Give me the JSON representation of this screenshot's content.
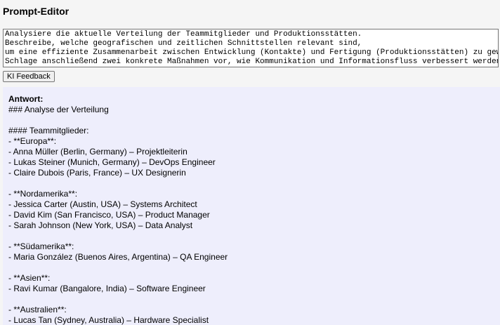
{
  "header": {
    "title": "Prompt-Editor"
  },
  "prompt": {
    "text": "Analysiere die aktuelle Verteilung der Teammitglieder und Produktionsstätten.\nBeschreibe, welche geografischen und zeitlichen Schnittstellen relevant sind,\num eine effiziente Zusammenarbeit zwischen Entwicklung (Kontakte) und Fertigung (Produktionsstätten) zu gewährleisten.\nSchlage anschließend zwei konkrete Maßnahmen vor, wie Kommunikation und Informationsfluss verbessert werden könnten."
  },
  "toolbar": {
    "feedback_label": "KI Feedback"
  },
  "answer": {
    "heading": "Antwort:",
    "lines": [
      "### Analyse der Verteilung",
      "",
      "#### Teammitglieder:",
      "- **Europa**:",
      "- Anna Müller (Berlin, Germany) – Projektleiterin",
      "- Lukas Steiner (Munich, Germany) – DevOps Engineer",
      "- Claire Dubois (Paris, France) – UX Designerin",
      "",
      "- **Nordamerika**:",
      "- Jessica Carter (Austin, USA) – Systems Architect",
      "- David Kim (San Francisco, USA) – Product Manager",
      "- Sarah Johnson (New York, USA) – Data Analyst",
      "",
      "- **Südamerika**:",
      "- Maria González (Buenos Aires, Argentina) – QA Engineer",
      "",
      "- **Asien**:",
      "- Ravi Kumar (Bangalore, India) – Software Engineer",
      "",
      "- **Australien**:",
      "- Lucas Tan (Sydney, Australia) – Hardware Specialist"
    ]
  },
  "colors": {
    "answer_background": "#eeeefc",
    "page_background": "#f5f5f5"
  }
}
